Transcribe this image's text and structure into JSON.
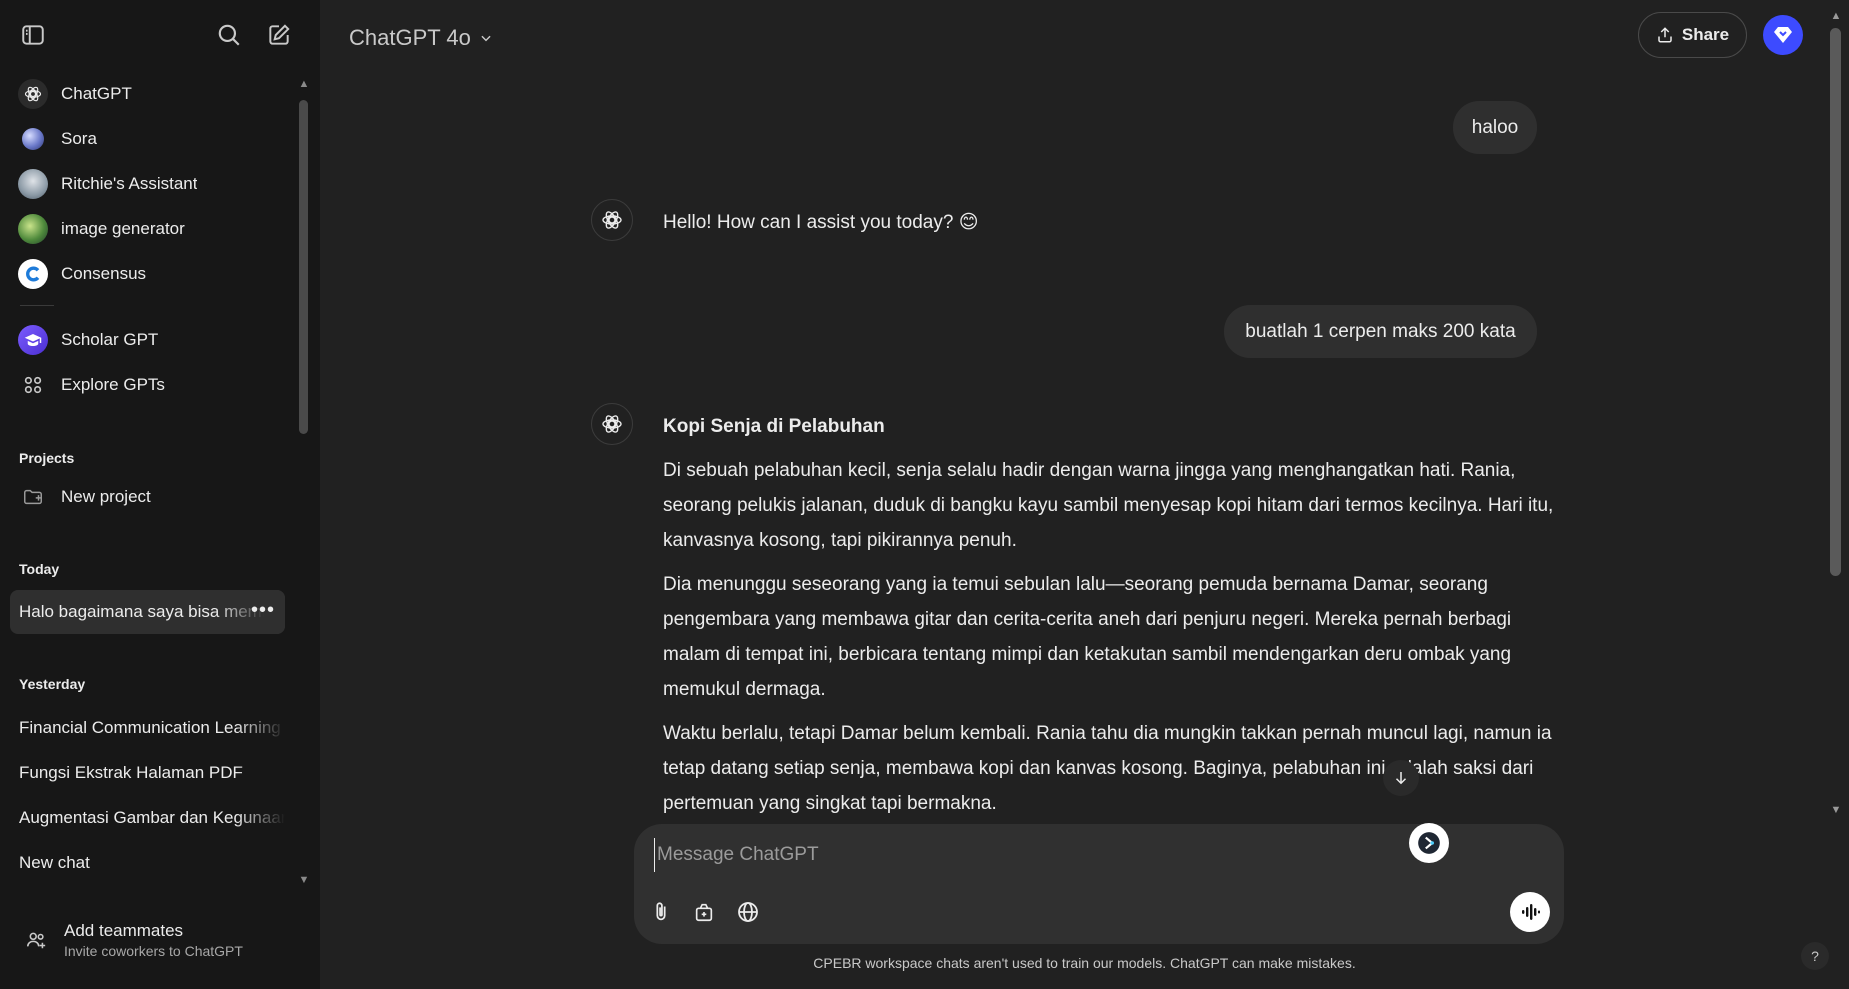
{
  "sidebar": {
    "gpts": [
      {
        "label": "ChatGPT",
        "icon": "openai-logo-icon"
      },
      {
        "label": "Sora",
        "icon": "sora-orb-icon"
      },
      {
        "label": "Ritchie's Assistant",
        "icon": "ritchie-avatar-icon"
      },
      {
        "label": "image generator",
        "icon": "image-generator-avatar-icon"
      },
      {
        "label": "Consensus",
        "icon": "consensus-logo-icon"
      },
      {
        "label": "Scholar GPT",
        "icon": "scholar-logo-icon"
      },
      {
        "label": "Explore GPTs",
        "icon": "grid-icon"
      }
    ],
    "projects_heading": "Projects",
    "new_project_label": "New project",
    "today_heading": "Today",
    "today_chats": [
      {
        "title": "Halo bagaimana saya bisa membantu"
      }
    ],
    "yesterday_heading": "Yesterday",
    "yesterday_chats": [
      {
        "title": "Financial Communication Learning"
      },
      {
        "title": "Fungsi Ekstrak Halaman PDF"
      },
      {
        "title": "Augmentasi Gambar dan Kegunaan"
      },
      {
        "title": "New chat"
      }
    ],
    "teammates": {
      "title": "Add teammates",
      "subtitle": "Invite coworkers to ChatGPT"
    }
  },
  "header": {
    "model_name": "ChatGPT 4o",
    "share_label": "Share"
  },
  "conversation": {
    "user_msg_1": "haloo",
    "assistant_msg_1": "Hello! How can I assist you today? 😊",
    "user_msg_2": "buatlah 1 cerpen maks 200 kata",
    "assistant_msg_2": {
      "title": "Kopi Senja di Pelabuhan",
      "p1": "Di sebuah pelabuhan kecil, senja selalu hadir dengan warna jingga yang menghangatkan hati. Rania, seorang pelukis jalanan, duduk di bangku kayu sambil menyesap kopi hitam dari termos kecilnya. Hari itu, kanvasnya kosong, tapi pikirannya penuh.",
      "p2": "Dia menunggu seseorang yang ia temui sebulan lalu—seorang pemuda bernama Damar, seorang pengembara yang membawa gitar dan cerita-cerita aneh dari penjuru negeri. Mereka pernah berbagi malam di tempat ini, berbicara tentang mimpi dan ketakutan sambil mendengarkan deru ombak yang memukul dermaga.",
      "p3": "Waktu berlalu, tetapi Damar belum kembali. Rania tahu dia mungkin takkan pernah muncul lagi, namun ia tetap datang setiap senja, membawa kopi dan kanvas kosong. Baginya, pelabuhan ini adalah saksi dari pertemuan yang singkat tapi bermakna."
    }
  },
  "composer": {
    "placeholder": "Message ChatGPT",
    "value": ""
  },
  "footer": {
    "disclaimer": "CPEBR workspace chats aren't used to train our models. ChatGPT can make mistakes.",
    "help_label": "?"
  },
  "colors": {
    "sidebar_bg": "#171717",
    "main_bg": "#212121",
    "bubble_bg": "#2f2f2f",
    "accent": "#3d4bff"
  }
}
